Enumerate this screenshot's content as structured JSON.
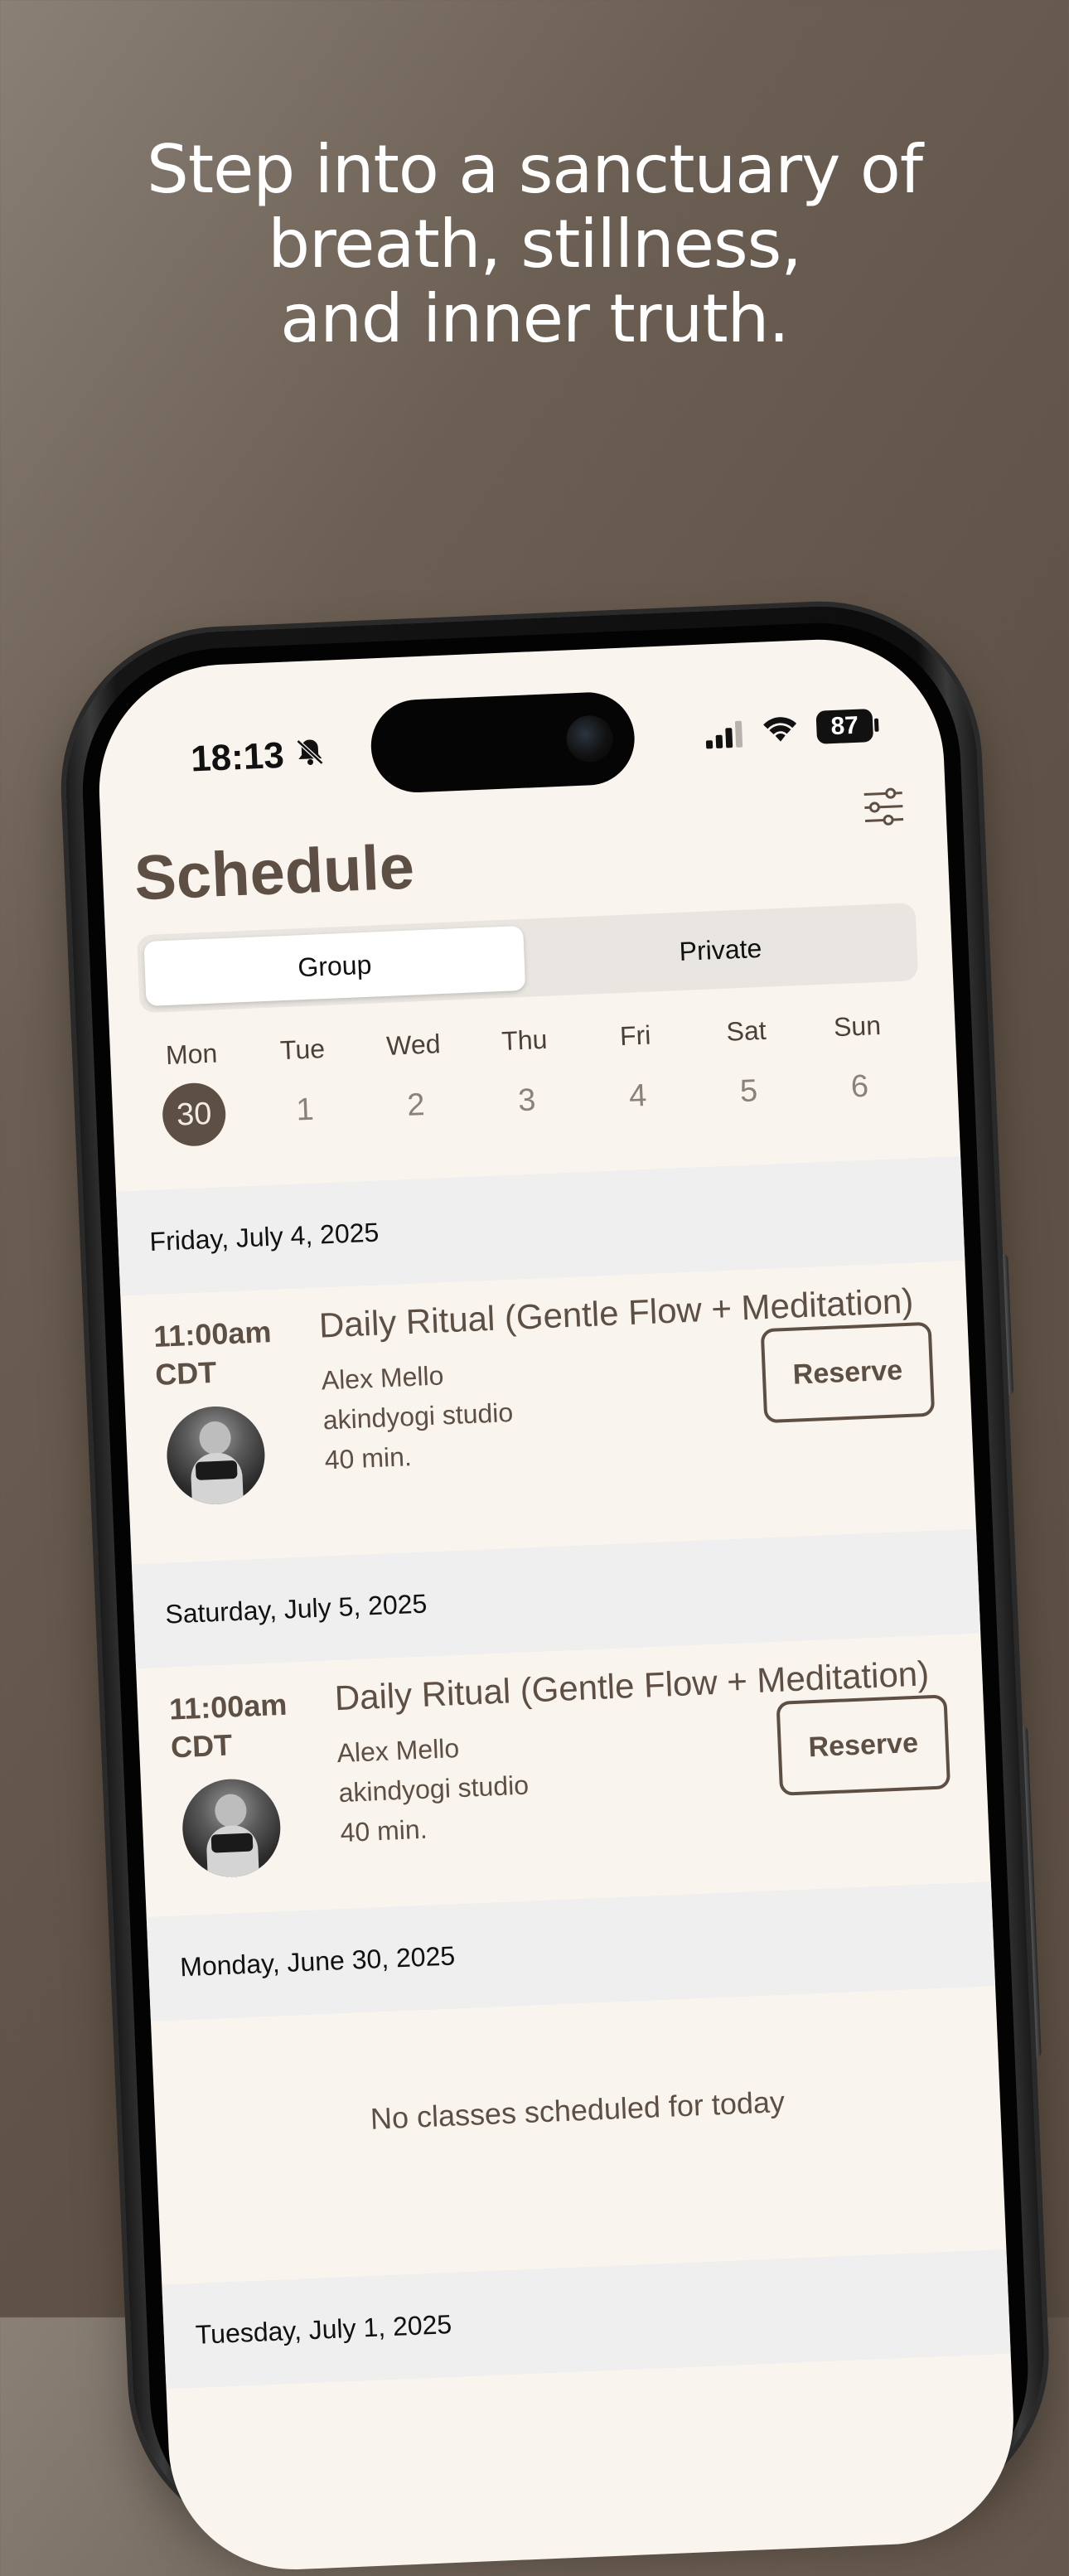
{
  "headline": {
    "line1": "Step into a sanctuary of",
    "line2": "breath, stillness,",
    "line3": "and inner truth."
  },
  "status_bar": {
    "time": "18:13",
    "battery": "87",
    "icons": [
      "bell-slash-icon",
      "cellular-signal-icon",
      "wifi-icon",
      "battery-icon"
    ]
  },
  "header": {
    "title": "Schedule",
    "filter_icon": "sliders-icon"
  },
  "tabs": [
    {
      "label": "Group",
      "active": true
    },
    {
      "label": "Private",
      "active": false
    }
  ],
  "week": [
    {
      "name": "Mon",
      "num": "30",
      "selected": true
    },
    {
      "name": "Tue",
      "num": "1",
      "selected": false
    },
    {
      "name": "Wed",
      "num": "2",
      "selected": false
    },
    {
      "name": "Thu",
      "num": "3",
      "selected": false
    },
    {
      "name": "Fri",
      "num": "4",
      "selected": false
    },
    {
      "name": "Sat",
      "num": "5",
      "selected": false
    },
    {
      "name": "Sun",
      "num": "6",
      "selected": false
    }
  ],
  "sections": [
    {
      "date": "Friday, July 4, 2025",
      "class": {
        "time": "11:00am",
        "tz": "CDT",
        "name": "Daily Ritual (Gentle Flow + Meditation)",
        "instructor": "Alex Mello",
        "studio": "akindyogi studio",
        "duration": "40 min.",
        "action": "Reserve"
      }
    },
    {
      "date": "Saturday, July 5, 2025",
      "class": {
        "time": "11:00am",
        "tz": "CDT",
        "name": "Daily Ritual (Gentle Flow + Meditation)",
        "instructor": "Alex Mello",
        "studio": "akindyogi studio",
        "duration": "40 min.",
        "action": "Reserve"
      }
    },
    {
      "date": "Monday, June 30, 2025",
      "empty_message": "No classes scheduled for today"
    },
    {
      "date": "Tuesday, July 1, 2025"
    }
  ],
  "colors": {
    "background": "#5f5145",
    "screen": "#faf4ee",
    "accent": "#5d4f43",
    "section_bg": "#efefef"
  }
}
